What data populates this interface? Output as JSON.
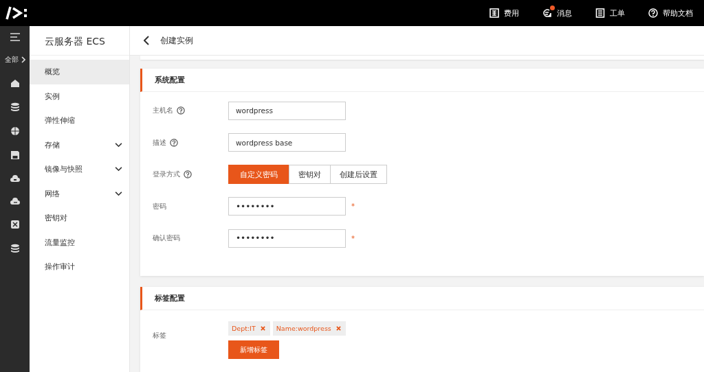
{
  "top_bar": {
    "items": [
      {
        "label": "费用",
        "badge": false
      },
      {
        "label": "消息",
        "badge": true
      },
      {
        "label": "工单",
        "badge": false
      },
      {
        "label": "帮助文档",
        "badge": false
      }
    ]
  },
  "rail": {
    "all_label": "全部"
  },
  "sidebar": {
    "title": "云服务器 ECS",
    "items": [
      {
        "label": "概览",
        "selected": true,
        "expandable": false
      },
      {
        "label": "实例",
        "selected": false,
        "expandable": false
      },
      {
        "label": "弹性伸缩",
        "selected": false,
        "expandable": false
      },
      {
        "label": "存储",
        "selected": false,
        "expandable": true
      },
      {
        "label": "镜像与快照",
        "selected": false,
        "expandable": true
      },
      {
        "label": "网络",
        "selected": false,
        "expandable": true
      },
      {
        "label": "密钥对",
        "selected": false,
        "expandable": false
      },
      {
        "label": "流量监控",
        "selected": false,
        "expandable": false
      },
      {
        "label": "操作审计",
        "selected": false,
        "expandable": false
      }
    ]
  },
  "page": {
    "title": "创建实例"
  },
  "system_config": {
    "title": "系统配置",
    "fields": [
      {
        "kind": "text",
        "label": "主机名",
        "help": true,
        "value": "wordpress"
      },
      {
        "kind": "text",
        "label": "描述",
        "help": true,
        "value": "wordpress base"
      },
      {
        "kind": "segmented",
        "label": "登录方式",
        "help": true,
        "options": [
          {
            "label": "自定义密码",
            "selected": true
          },
          {
            "label": "密钥对",
            "selected": false
          },
          {
            "label": "创建后设置",
            "selected": false
          }
        ]
      },
      {
        "kind": "password",
        "label": "密码",
        "help": false,
        "value": "••••••••",
        "required_mark": "*"
      },
      {
        "kind": "password",
        "label": "确认密码",
        "help": false,
        "value": "••••••••",
        "required_mark": "*"
      }
    ]
  },
  "tag_config": {
    "title": "标签配置",
    "label": "标签",
    "tags": [
      "Dept:IT",
      "Name:wordpress"
    ],
    "add_button": "新增标签"
  }
}
